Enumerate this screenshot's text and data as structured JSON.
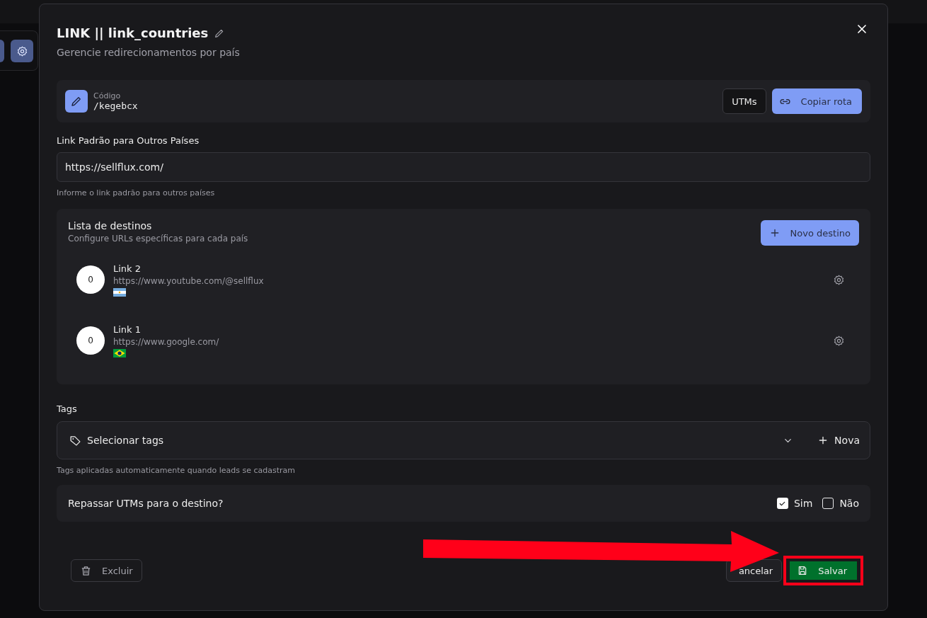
{
  "dialog": {
    "title": "LINK || link_countries",
    "subtitle": "Gerencie redirecionamentos por país"
  },
  "code": {
    "label": "Código",
    "value": "/kegebcx",
    "buttons": [
      {
        "kind": "outline",
        "label": "UTMs"
      },
      {
        "kind": "primary",
        "label": "Copiar rota"
      }
    ]
  },
  "default_link": {
    "label": "Link Padrão para Outros Países",
    "value": "https://sellflux.com/",
    "helper": "Informe o link padrão para outros países"
  },
  "destinations": {
    "title": "Lista de destinos",
    "subtitle": "Configure URLs específicas para cada país",
    "add_button": "Novo destino",
    "items": [
      {
        "count": "0",
        "name": "Link 2",
        "url": "https://www.youtube.com/@sellflux",
        "kind": "argentina"
      },
      {
        "count": "0",
        "name": "Link 1",
        "url": "https://www.google.com/",
        "kind": "brazil"
      }
    ]
  },
  "tags": {
    "label": "Tags",
    "placeholder": "Selecionar tags",
    "new_button": "Nova",
    "helper": "Tags aplicadas automaticamente quando leads se cadastram"
  },
  "pass_utms": {
    "question": "Repassar UTMs para o destino?",
    "options": [
      {
        "label": "Sim",
        "checked": true
      },
      {
        "label": "Não",
        "checked": false
      }
    ]
  },
  "footer": {
    "delete": "Excluir",
    "cancel": "ancelar",
    "save": "Salvar"
  }
}
